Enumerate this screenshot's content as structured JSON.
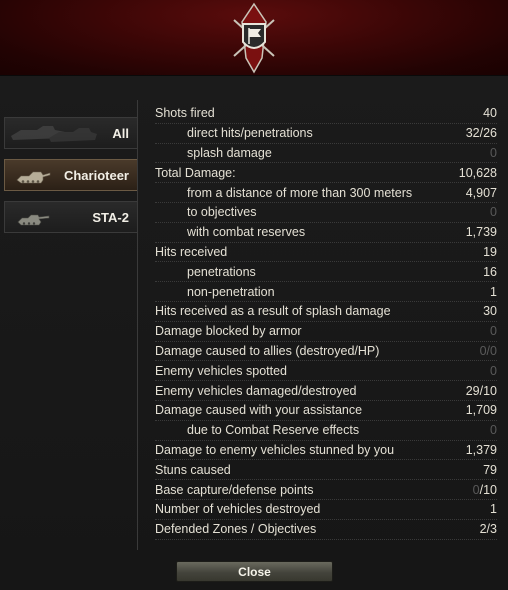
{
  "sidebar": {
    "items": [
      {
        "label": "All",
        "icon": "all-vehicles-icon",
        "active": false
      },
      {
        "label": "Charioteer",
        "icon": "tank-destroyer-icon",
        "active": true
      },
      {
        "label": "STA-2",
        "icon": "medium-tank-icon",
        "active": false
      }
    ]
  },
  "stats": [
    {
      "label": "Shots fired",
      "value": "40",
      "sub": false,
      "zero": false
    },
    {
      "label": "direct hits/penetrations",
      "value": "32/26",
      "sub": true,
      "zero": false
    },
    {
      "label": "splash damage",
      "value": "0",
      "sub": true,
      "zero": true
    },
    {
      "label": "Total Damage:",
      "value": "10,628",
      "sub": false,
      "zero": false
    },
    {
      "label": "from a distance of more than 300 meters",
      "value": "4,907",
      "sub": true,
      "zero": false
    },
    {
      "label": "to objectives",
      "value": "0",
      "sub": true,
      "zero": true
    },
    {
      "label": "with combat reserves",
      "value": "1,739",
      "sub": true,
      "zero": false
    },
    {
      "label": "Hits received",
      "value": "19",
      "sub": false,
      "zero": false
    },
    {
      "label": "penetrations",
      "value": "16",
      "sub": true,
      "zero": false
    },
    {
      "label": "non-penetration",
      "value": "1",
      "sub": true,
      "zero": false
    },
    {
      "label": "Hits received as a result of splash damage",
      "value": "30",
      "sub": false,
      "zero": false
    },
    {
      "label": "Damage blocked by armor",
      "value": "0",
      "sub": false,
      "zero": true
    },
    {
      "label": "Damage caused to allies (destroyed/HP)",
      "value": "0/0",
      "sub": false,
      "zero": true
    },
    {
      "label": "Enemy vehicles spotted",
      "value": "0",
      "sub": false,
      "zero": true
    },
    {
      "label": "Enemy vehicles damaged/destroyed",
      "value": "29/10",
      "sub": false,
      "zero": false
    },
    {
      "label": "Damage caused with your assistance",
      "value": "1,709",
      "sub": false,
      "zero": false
    },
    {
      "label": "due to Combat Reserve effects",
      "value": "0",
      "sub": true,
      "zero": true
    },
    {
      "label": "Damage to enemy vehicles stunned by you",
      "value": "1,379",
      "sub": false,
      "zero": false
    },
    {
      "label": "Stuns caused",
      "value": "79",
      "sub": false,
      "zero": false
    },
    {
      "label": "Base capture/defense points",
      "value_dim": "0",
      "value_rest": "/10",
      "sub": false,
      "zero": false
    },
    {
      "label": "Number of vehicles destroyed",
      "value": "1",
      "sub": false,
      "zero": false
    },
    {
      "label": "Defended Zones / Objectives",
      "value": "2/3",
      "sub": false,
      "zero": false
    }
  ],
  "footer": {
    "close_label": "Close"
  },
  "colors": {
    "header_red": "#3a0606",
    "zero_gray": "#5a5a5a",
    "active_tab": "#4a3a2a"
  }
}
